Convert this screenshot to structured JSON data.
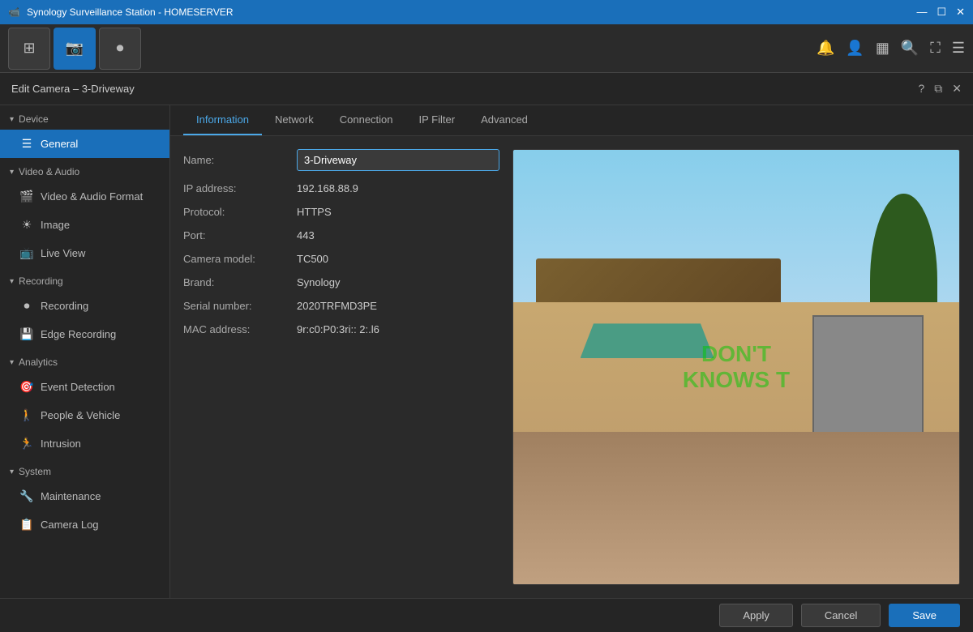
{
  "titlebar": {
    "title": "Synology Surveillance Station - HOMESERVER",
    "icon": "🎥",
    "controls": {
      "minimize": "—",
      "maximize": "☐",
      "close": "✕"
    }
  },
  "toolbar": {
    "buttons": [
      {
        "id": "grid-btn",
        "icon": "⊞",
        "active": false
      },
      {
        "id": "camera-btn",
        "icon": "📷",
        "active": true
      },
      {
        "id": "record-btn",
        "icon": "⏺",
        "active": false
      }
    ],
    "right_icons": [
      {
        "id": "notification-icon",
        "icon": "🔔"
      },
      {
        "id": "user-icon",
        "icon": "👤"
      },
      {
        "id": "layout-icon",
        "icon": "▦"
      },
      {
        "id": "search-icon",
        "icon": "🔍"
      },
      {
        "id": "fullscreen-icon",
        "icon": "⛶"
      },
      {
        "id": "menu-icon",
        "icon": "☰"
      }
    ]
  },
  "subheader": {
    "title": "Edit Camera – 3-Driveway",
    "actions": [
      {
        "id": "help-icon",
        "icon": "?"
      },
      {
        "id": "popout-icon",
        "icon": "⧉"
      },
      {
        "id": "close-icon",
        "icon": "✕"
      }
    ]
  },
  "sidebar": {
    "sections": [
      {
        "id": "device-section",
        "label": "Device",
        "items": [
          {
            "id": "general-item",
            "icon": "☰",
            "label": "General",
            "active": true
          }
        ]
      },
      {
        "id": "video-audio-section",
        "label": "Video & Audio",
        "items": [
          {
            "id": "video-audio-format-item",
            "icon": "🎬",
            "label": "Video & Audio Format",
            "active": false
          },
          {
            "id": "image-item",
            "icon": "☀",
            "label": "Image",
            "active": false
          },
          {
            "id": "live-view-item",
            "icon": "📺",
            "label": "Live View",
            "active": false
          }
        ]
      },
      {
        "id": "recording-section",
        "label": "Recording",
        "items": [
          {
            "id": "recording-item",
            "icon": "⏺",
            "label": "Recording",
            "active": false
          },
          {
            "id": "edge-recording-item",
            "icon": "💾",
            "label": "Edge Recording",
            "active": false
          }
        ]
      },
      {
        "id": "analytics-section",
        "label": "Analytics",
        "items": [
          {
            "id": "event-detection-item",
            "icon": "🎯",
            "label": "Event Detection",
            "active": false
          },
          {
            "id": "people-vehicle-item",
            "icon": "🚶",
            "label": "People & Vehicle",
            "active": false
          },
          {
            "id": "intrusion-item",
            "icon": "🏃",
            "label": "Intrusion",
            "active": false
          }
        ]
      },
      {
        "id": "system-section",
        "label": "System",
        "items": [
          {
            "id": "maintenance-item",
            "icon": "🔧",
            "label": "Maintenance",
            "active": false
          },
          {
            "id": "camera-log-item",
            "icon": "📋",
            "label": "Camera Log",
            "active": false
          }
        ]
      }
    ]
  },
  "tabs": [
    {
      "id": "information-tab",
      "label": "Information",
      "active": true
    },
    {
      "id": "network-tab",
      "label": "Network",
      "active": false
    },
    {
      "id": "connection-tab",
      "label": "Connection",
      "active": false
    },
    {
      "id": "ipfilter-tab",
      "label": "IP Filter",
      "active": false
    },
    {
      "id": "advanced-tab",
      "label": "Advanced",
      "active": false
    }
  ],
  "form": {
    "fields": [
      {
        "id": "name-field",
        "label": "Name:",
        "value": "3-Driveway",
        "editable": true
      },
      {
        "id": "ip-field",
        "label": "IP address:",
        "value": "192.168.88.9",
        "editable": false
      },
      {
        "id": "protocol-field",
        "label": "Protocol:",
        "value": "HTTPS",
        "editable": false
      },
      {
        "id": "port-field",
        "label": "Port:",
        "value": "443",
        "editable": false
      },
      {
        "id": "model-field",
        "label": "Camera model:",
        "value": "TC500",
        "editable": false
      },
      {
        "id": "brand-field",
        "label": "Brand:",
        "value": "Synology",
        "editable": false
      },
      {
        "id": "serial-field",
        "label": "Serial number:",
        "value": "2020TRFMD3PE",
        "editable": false
      },
      {
        "id": "mac-field",
        "label": "MAC address:",
        "value": "9r:c0:P0:3ri:: 2:.l6",
        "editable": false
      }
    ]
  },
  "watermark": {
    "line1": "DON'T",
    "line2": "KNOWS T"
  },
  "footer": {
    "apply_label": "Apply",
    "cancel_label": "Cancel",
    "save_label": "Save"
  }
}
